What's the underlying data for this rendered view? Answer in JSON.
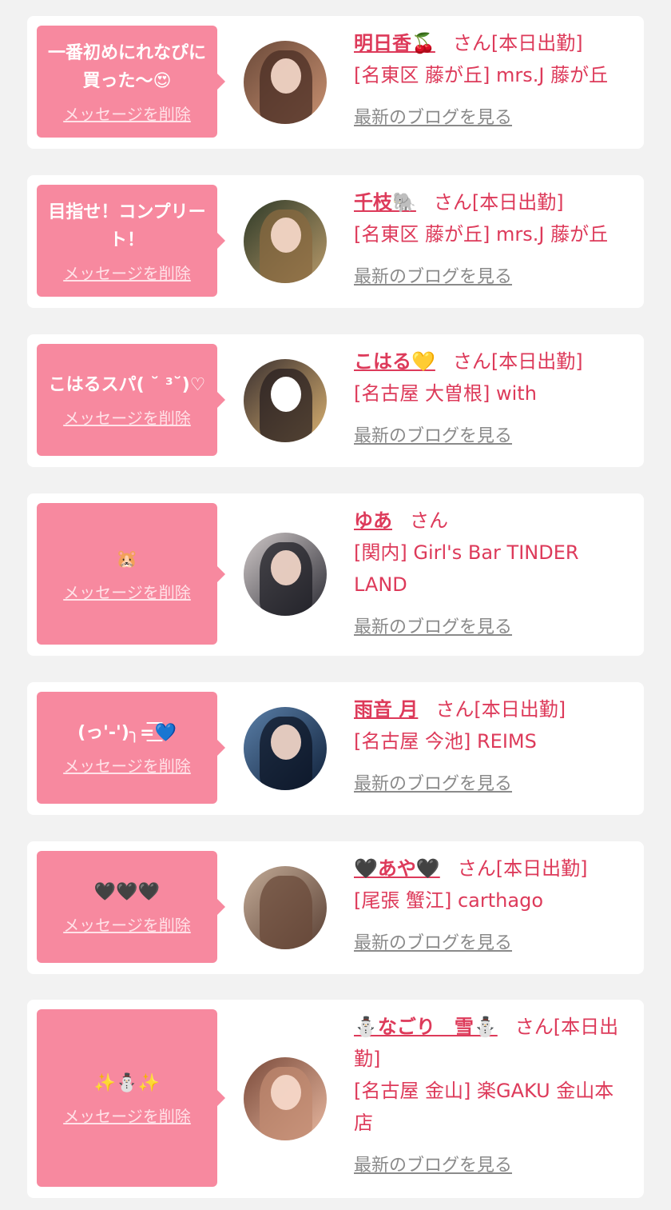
{
  "cards": [
    {
      "message": "一番初めにれなぴに買った〜😍",
      "delete_label": "メッセージを削除",
      "name": "明日香🍒",
      "honorific": "さん[本日出勤]",
      "shop": "[名東区 藤が丘] mrs.J 藤が丘",
      "blog_label": "最新のブログを見る",
      "avatar_colors": [
        "#6b4a3a",
        "#c89070"
      ]
    },
    {
      "message": "目指せ！コンプリート！",
      "delete_label": "メッセージを削除",
      "name": "千枝🐘",
      "honorific": "さん[本日出勤]",
      "shop": "[名東区 藤が丘] mrs.J 藤が丘",
      "blog_label": "最新のブログを見る",
      "avatar_colors": [
        "#2e3a28",
        "#b89a6a"
      ]
    },
    {
      "message": "こはるスパ( ˘ ³˘)♡",
      "delete_label": "メッセージを削除",
      "name": "こはる💛",
      "honorific": "さん[本日出勤]",
      "shop": "[名古屋 大曽根] with",
      "blog_label": "最新のブログを見る",
      "avatar_colors": [
        "#3a3030",
        "#d8b070"
      ]
    },
    {
      "message": "🐹",
      "delete_label": "メッセージを削除",
      "name": "ゆあ",
      "honorific": "さん",
      "shop": "[関内] Girl's Bar TINDER LAND",
      "blog_label": "最新のブログを見る",
      "avatar_colors": [
        "#2c2c34",
        "#cfc8c8"
      ]
    },
    {
      "message": "(っ'-')╮=͟͟͞͞💙",
      "delete_label": "メッセージを削除",
      "name": "雨音 月",
      "honorific": "さん[本日出勤]",
      "shop": "[名古屋 今池] REIMS",
      "blog_label": "最新のブログを見る",
      "avatar_colors": [
        "#10213a",
        "#5a7fa8"
      ]
    },
    {
      "message": "🖤🖤🖤",
      "delete_label": "メッセージを削除",
      "name": "🖤あや🖤",
      "honorific": "さん[本日出勤]",
      "shop": "[尾張 蟹江] carthago",
      "blog_label": "最新のブログを見る",
      "avatar_colors": [
        "#5a4034",
        "#c2aa96"
      ]
    },
    {
      "message": "✨⛄✨",
      "delete_label": "メッセージを削除",
      "name": "⛄なごり　雪⛄",
      "honorific": "さん[本日出勤]",
      "shop": "[名古屋 金山] 楽GAKU 金山本店",
      "blog_label": "最新のブログを見る",
      "avatar_colors": [
        "#7a4a3a",
        "#e8b8a0"
      ]
    }
  ]
}
